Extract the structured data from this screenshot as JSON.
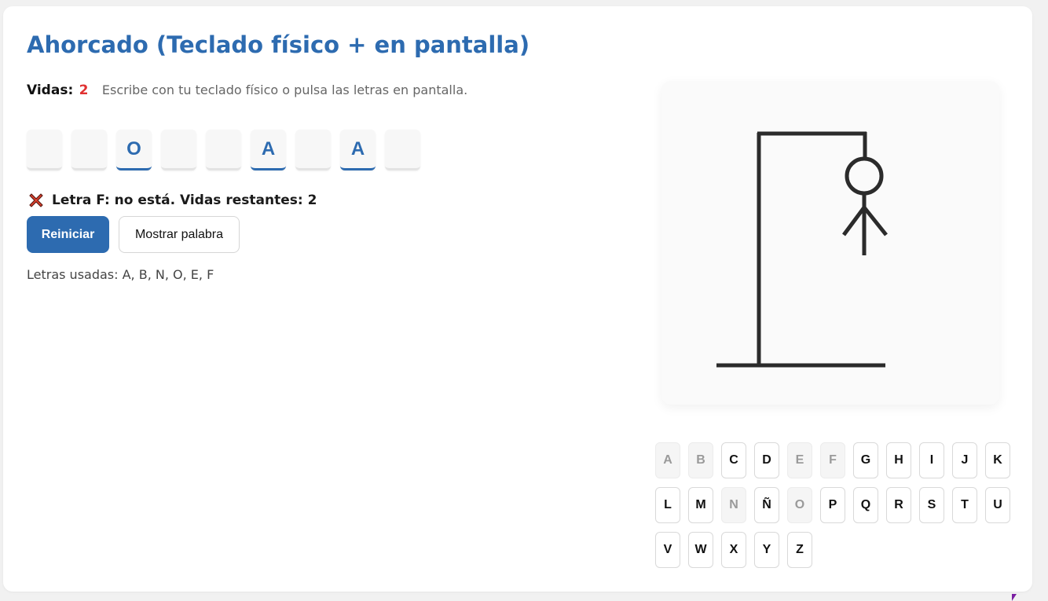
{
  "title": "Ahorcado (Teclado físico + en pantalla)",
  "status": {
    "lives_label": "Vidas:",
    "lives_value": "2",
    "hint": "Escribe con tu teclado físico o pulsa las letras en pantalla."
  },
  "word_slots": [
    "",
    "",
    "O",
    "",
    "",
    "A",
    "",
    "A",
    ""
  ],
  "message": {
    "icon": "cross-mark-icon",
    "text": "Letra F: no está. Vidas restantes: 2"
  },
  "buttons": {
    "restart_label": "Reiniciar",
    "show_word_label": "Mostrar palabra"
  },
  "used_letters": "Letras usadas: A, B, N, O, E, F",
  "gallows": {
    "parts_drawn": [
      "base",
      "pole",
      "beam",
      "rope",
      "head",
      "body",
      "left-arm",
      "right-arm"
    ],
    "stroke_color": "#2b2b2b"
  },
  "keyboard": {
    "keys": [
      "A",
      "B",
      "C",
      "D",
      "E",
      "F",
      "G",
      "H",
      "I",
      "J",
      "K",
      "L",
      "M",
      "N",
      "Ñ",
      "O",
      "P",
      "Q",
      "R",
      "S",
      "T",
      "U",
      "V",
      "W",
      "X",
      "Y",
      "Z"
    ],
    "used": [
      "A",
      "B",
      "E",
      "F",
      "N",
      "O"
    ]
  },
  "colors": {
    "accent": "#2d6bb0",
    "lives": "#e03131"
  }
}
